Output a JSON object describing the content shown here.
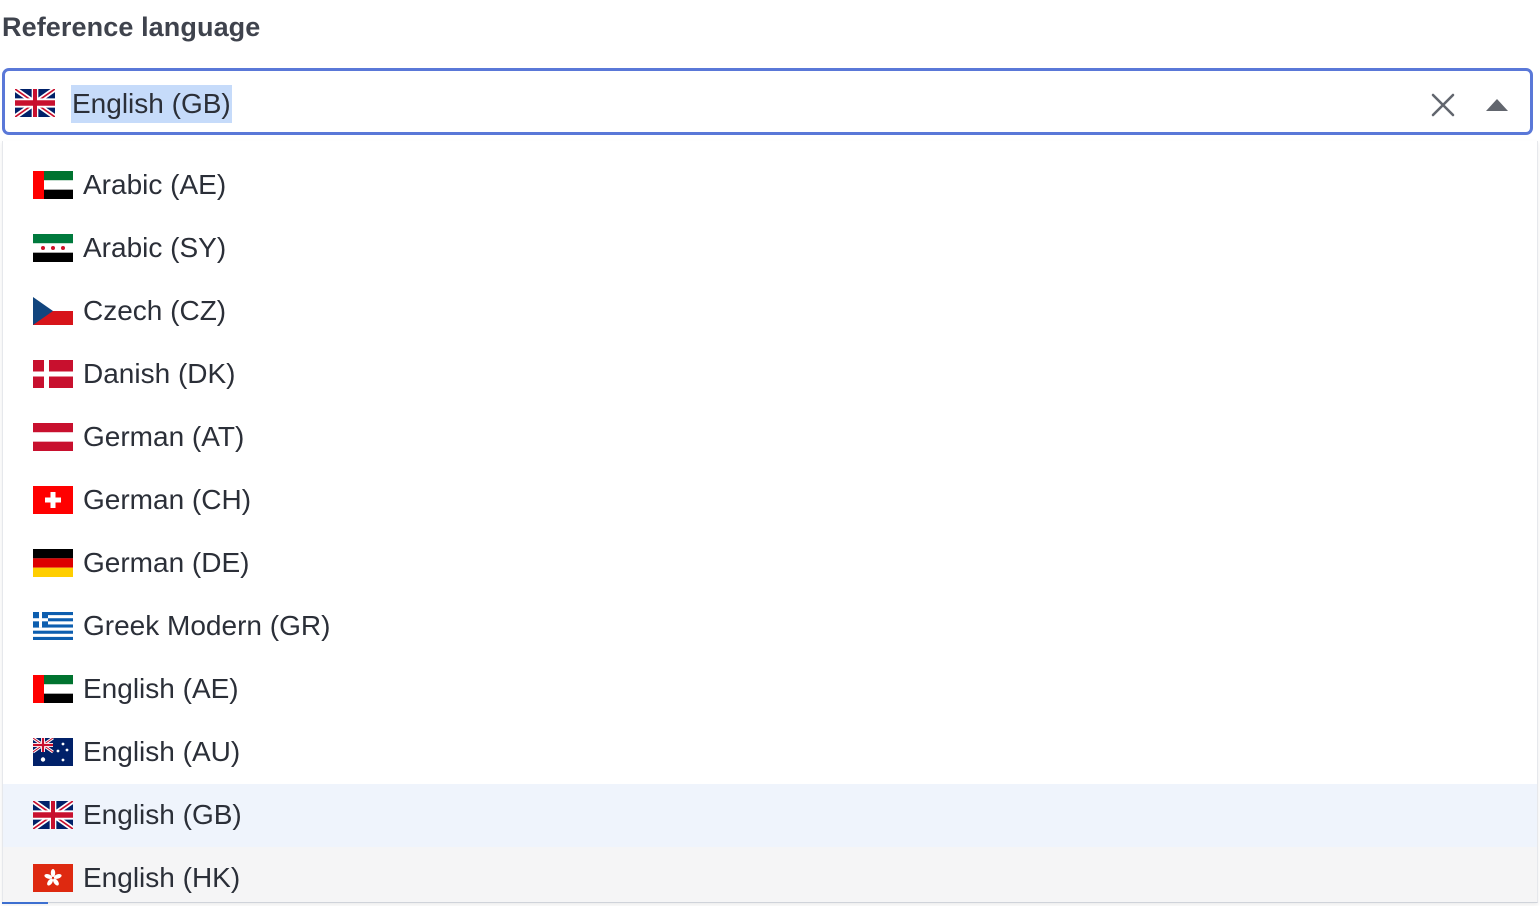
{
  "field": {
    "label": "Reference language"
  },
  "select": {
    "value": "English (GB)",
    "flag_icon": "flag-gb-icon",
    "clear_icon": "close-icon",
    "toggle_icon": "caret-up-icon"
  },
  "options": [
    {
      "label": "Arabic (AE)",
      "flag_icon": "flag-ae-icon",
      "state": "normal"
    },
    {
      "label": "Arabic (SY)",
      "flag_icon": "flag-sy-icon",
      "state": "normal"
    },
    {
      "label": "Czech (CZ)",
      "flag_icon": "flag-cz-icon",
      "state": "normal"
    },
    {
      "label": "Danish (DK)",
      "flag_icon": "flag-dk-icon",
      "state": "normal"
    },
    {
      "label": "German (AT)",
      "flag_icon": "flag-at-icon",
      "state": "normal"
    },
    {
      "label": "German (CH)",
      "flag_icon": "flag-ch-icon",
      "state": "normal"
    },
    {
      "label": "German (DE)",
      "flag_icon": "flag-de-icon",
      "state": "normal"
    },
    {
      "label": "Greek Modern (GR)",
      "flag_icon": "flag-gr-icon",
      "state": "normal"
    },
    {
      "label": "English (AE)",
      "flag_icon": "flag-ae-icon",
      "state": "normal"
    },
    {
      "label": "English (AU)",
      "flag_icon": "flag-au-icon",
      "state": "normal"
    },
    {
      "label": "English (GB)",
      "flag_icon": "flag-gb-icon",
      "state": "selected"
    },
    {
      "label": "English (HK)",
      "flag_icon": "flag-hk-icon",
      "state": "hovered"
    }
  ],
  "colors": {
    "focus_border": "#5a78d8",
    "selection_highlight": "#c6dbfa",
    "selected_row": "#eff4fc",
    "hovered_row": "#f5f5f6"
  }
}
